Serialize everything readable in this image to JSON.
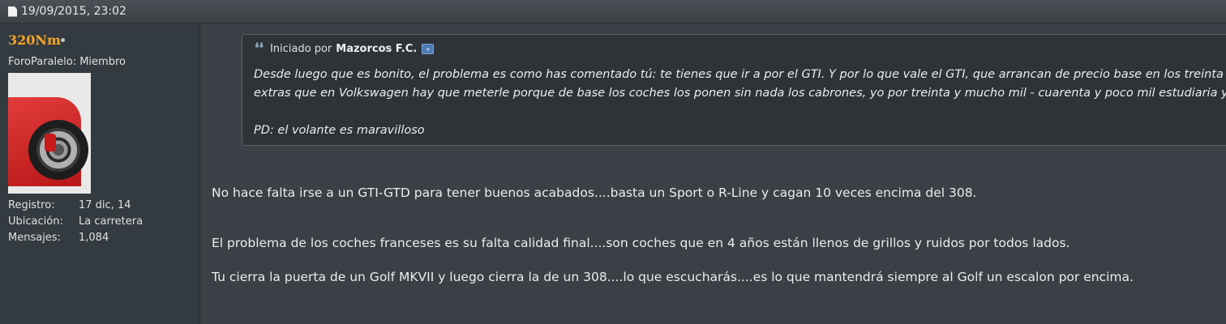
{
  "post": {
    "date": "19/09/2015, 23:02"
  },
  "user": {
    "name": "320Nm",
    "rank": "ForoParalelo: Miembro",
    "stats": [
      {
        "label": "Registro:",
        "value": "17 dic, 14"
      },
      {
        "label": "Ubicación:",
        "value": "La carretera"
      },
      {
        "label": "Mensajes:",
        "value": "1,084"
      }
    ]
  },
  "quote": {
    "prefix": "Iniciado por",
    "author": "Mazorcos F.C.",
    "lines": [
      "Desde luego que es bonito, el problema es como has comentado tú: te tienes que ir a por el GTI. Y por lo que vale el GTI, que arrancan de precio base en los treinta y",
      "extras que en Volkswagen hay que meterle porque de base los coches los ponen sin nada los cabrones, yo por treinta y mucho mil - cuarenta y poco mil estudiaria ya r",
      "PD: el volante es maravilloso"
    ]
  },
  "message": {
    "paragraphs": [
      "No hace falta irse a un GTI-GTD para tener buenos acabados....basta un Sport o R-Line y cagan 10 veces encima del 308.",
      "El problema de los coches franceses es su falta calidad final....son coches que en 4 años están llenos de grillos y ruidos por todos lados.",
      "Tu cierra la puerta de un Golf MKVII y luego cierra la de un 308....lo que escucharás....es lo que mantendrá siempre al Golf un escalon por encima."
    ]
  },
  "icons": {
    "doc": "document-icon",
    "quote": "quote-icon",
    "view_post": "view-post-icon",
    "status": "online-status-icon"
  },
  "colors": {
    "username": "#f5a623",
    "background": "#3a4046",
    "sidebar": "#333a40"
  }
}
